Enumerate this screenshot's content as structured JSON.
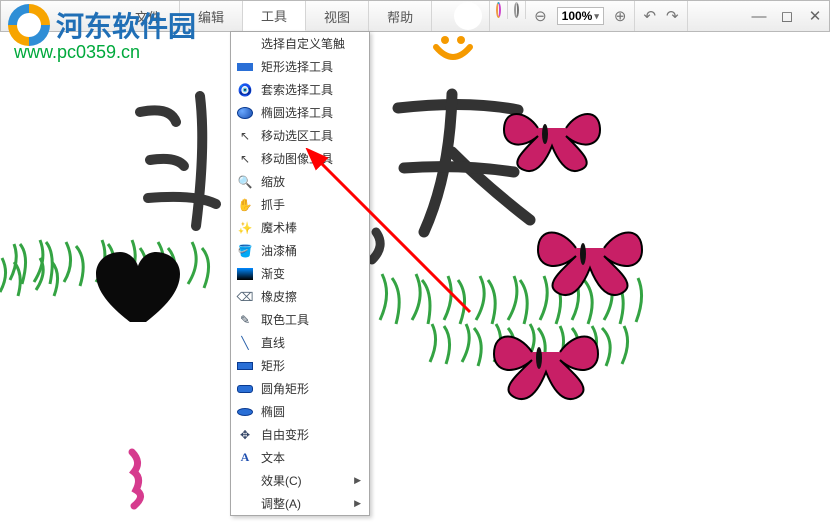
{
  "watermark": {
    "brand": "河东软件园",
    "url": "www.pc0359.cn"
  },
  "menu": {
    "items": [
      "文件",
      "编辑",
      "工具",
      "视图",
      "帮助"
    ],
    "open_index": 2
  },
  "zoom": {
    "value": "100%"
  },
  "tools_dropdown": {
    "items": [
      {
        "icon": "blank",
        "label": "选择自定义笔触"
      },
      {
        "icon": "rect",
        "label": "矩形选择工具"
      },
      {
        "icon": "lasso",
        "label": "套索选择工具"
      },
      {
        "icon": "ellipse-sel",
        "label": "椭圆选择工具"
      },
      {
        "icon": "arrow",
        "label": "移动选区工具"
      },
      {
        "icon": "arrow2",
        "label": "移动图像工具"
      },
      {
        "icon": "zoom",
        "label": "缩放"
      },
      {
        "icon": "hand",
        "label": "抓手"
      },
      {
        "icon": "wand",
        "label": "魔术棒"
      },
      {
        "icon": "bucket",
        "label": "油漆桶"
      },
      {
        "icon": "grad",
        "label": "渐变"
      },
      {
        "icon": "erase",
        "label": "橡皮擦"
      },
      {
        "icon": "pick",
        "label": "取色工具"
      },
      {
        "icon": "line",
        "label": "直线"
      },
      {
        "icon": "rect2",
        "label": "矩形"
      },
      {
        "icon": "rrect",
        "label": "圆角矩形"
      },
      {
        "icon": "ell",
        "label": "椭圆"
      },
      {
        "icon": "free",
        "label": "自由变形"
      },
      {
        "icon": "text",
        "label": "文本"
      },
      {
        "icon": "blank",
        "label": "效果(C)",
        "submenu": true
      },
      {
        "icon": "blank",
        "label": "调整(A)",
        "submenu": true
      }
    ]
  },
  "icons": {
    "lasso": "🧿",
    "arrow": "↖",
    "arrow2": "↖",
    "zoom": "🔍",
    "hand": "✋",
    "wand": "✨",
    "bucket": "🪣",
    "erase": "⌫",
    "pick": "✎",
    "line": "╲",
    "free": "✥",
    "text": "A"
  }
}
